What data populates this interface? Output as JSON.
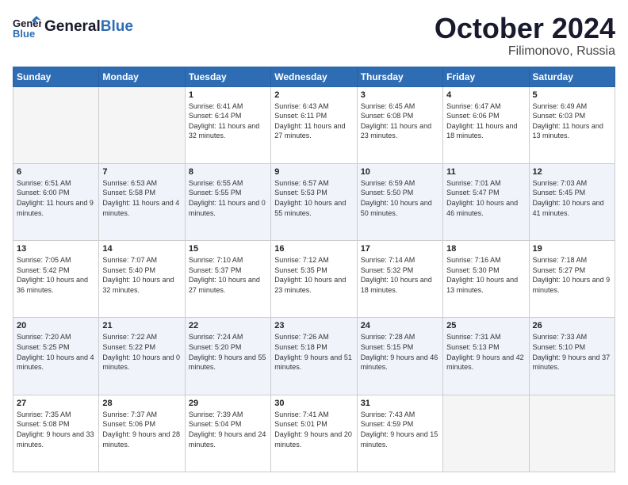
{
  "header": {
    "logo_general": "General",
    "logo_blue": "Blue",
    "month": "October 2024",
    "location": "Filimonovo, Russia"
  },
  "weekdays": [
    "Sunday",
    "Monday",
    "Tuesday",
    "Wednesday",
    "Thursday",
    "Friday",
    "Saturday"
  ],
  "weeks": [
    [
      {
        "day": "",
        "empty": true
      },
      {
        "day": "",
        "empty": true
      },
      {
        "day": "1",
        "sunrise": "Sunrise: 6:41 AM",
        "sunset": "Sunset: 6:14 PM",
        "daylight": "Daylight: 11 hours and 32 minutes."
      },
      {
        "day": "2",
        "sunrise": "Sunrise: 6:43 AM",
        "sunset": "Sunset: 6:11 PM",
        "daylight": "Daylight: 11 hours and 27 minutes."
      },
      {
        "day": "3",
        "sunrise": "Sunrise: 6:45 AM",
        "sunset": "Sunset: 6:08 PM",
        "daylight": "Daylight: 11 hours and 23 minutes."
      },
      {
        "day": "4",
        "sunrise": "Sunrise: 6:47 AM",
        "sunset": "Sunset: 6:06 PM",
        "daylight": "Daylight: 11 hours and 18 minutes."
      },
      {
        "day": "5",
        "sunrise": "Sunrise: 6:49 AM",
        "sunset": "Sunset: 6:03 PM",
        "daylight": "Daylight: 11 hours and 13 minutes."
      }
    ],
    [
      {
        "day": "6",
        "sunrise": "Sunrise: 6:51 AM",
        "sunset": "Sunset: 6:00 PM",
        "daylight": "Daylight: 11 hours and 9 minutes."
      },
      {
        "day": "7",
        "sunrise": "Sunrise: 6:53 AM",
        "sunset": "Sunset: 5:58 PM",
        "daylight": "Daylight: 11 hours and 4 minutes."
      },
      {
        "day": "8",
        "sunrise": "Sunrise: 6:55 AM",
        "sunset": "Sunset: 5:55 PM",
        "daylight": "Daylight: 11 hours and 0 minutes."
      },
      {
        "day": "9",
        "sunrise": "Sunrise: 6:57 AM",
        "sunset": "Sunset: 5:53 PM",
        "daylight": "Daylight: 10 hours and 55 minutes."
      },
      {
        "day": "10",
        "sunrise": "Sunrise: 6:59 AM",
        "sunset": "Sunset: 5:50 PM",
        "daylight": "Daylight: 10 hours and 50 minutes."
      },
      {
        "day": "11",
        "sunrise": "Sunrise: 7:01 AM",
        "sunset": "Sunset: 5:47 PM",
        "daylight": "Daylight: 10 hours and 46 minutes."
      },
      {
        "day": "12",
        "sunrise": "Sunrise: 7:03 AM",
        "sunset": "Sunset: 5:45 PM",
        "daylight": "Daylight: 10 hours and 41 minutes."
      }
    ],
    [
      {
        "day": "13",
        "sunrise": "Sunrise: 7:05 AM",
        "sunset": "Sunset: 5:42 PM",
        "daylight": "Daylight: 10 hours and 36 minutes."
      },
      {
        "day": "14",
        "sunrise": "Sunrise: 7:07 AM",
        "sunset": "Sunset: 5:40 PM",
        "daylight": "Daylight: 10 hours and 32 minutes."
      },
      {
        "day": "15",
        "sunrise": "Sunrise: 7:10 AM",
        "sunset": "Sunset: 5:37 PM",
        "daylight": "Daylight: 10 hours and 27 minutes."
      },
      {
        "day": "16",
        "sunrise": "Sunrise: 7:12 AM",
        "sunset": "Sunset: 5:35 PM",
        "daylight": "Daylight: 10 hours and 23 minutes."
      },
      {
        "day": "17",
        "sunrise": "Sunrise: 7:14 AM",
        "sunset": "Sunset: 5:32 PM",
        "daylight": "Daylight: 10 hours and 18 minutes."
      },
      {
        "day": "18",
        "sunrise": "Sunrise: 7:16 AM",
        "sunset": "Sunset: 5:30 PM",
        "daylight": "Daylight: 10 hours and 13 minutes."
      },
      {
        "day": "19",
        "sunrise": "Sunrise: 7:18 AM",
        "sunset": "Sunset: 5:27 PM",
        "daylight": "Daylight: 10 hours and 9 minutes."
      }
    ],
    [
      {
        "day": "20",
        "sunrise": "Sunrise: 7:20 AM",
        "sunset": "Sunset: 5:25 PM",
        "daylight": "Daylight: 10 hours and 4 minutes."
      },
      {
        "day": "21",
        "sunrise": "Sunrise: 7:22 AM",
        "sunset": "Sunset: 5:22 PM",
        "daylight": "Daylight: 10 hours and 0 minutes."
      },
      {
        "day": "22",
        "sunrise": "Sunrise: 7:24 AM",
        "sunset": "Sunset: 5:20 PM",
        "daylight": "Daylight: 9 hours and 55 minutes."
      },
      {
        "day": "23",
        "sunrise": "Sunrise: 7:26 AM",
        "sunset": "Sunset: 5:18 PM",
        "daylight": "Daylight: 9 hours and 51 minutes."
      },
      {
        "day": "24",
        "sunrise": "Sunrise: 7:28 AM",
        "sunset": "Sunset: 5:15 PM",
        "daylight": "Daylight: 9 hours and 46 minutes."
      },
      {
        "day": "25",
        "sunrise": "Sunrise: 7:31 AM",
        "sunset": "Sunset: 5:13 PM",
        "daylight": "Daylight: 9 hours and 42 minutes."
      },
      {
        "day": "26",
        "sunrise": "Sunrise: 7:33 AM",
        "sunset": "Sunset: 5:10 PM",
        "daylight": "Daylight: 9 hours and 37 minutes."
      }
    ],
    [
      {
        "day": "27",
        "sunrise": "Sunrise: 7:35 AM",
        "sunset": "Sunset: 5:08 PM",
        "daylight": "Daylight: 9 hours and 33 minutes."
      },
      {
        "day": "28",
        "sunrise": "Sunrise: 7:37 AM",
        "sunset": "Sunset: 5:06 PM",
        "daylight": "Daylight: 9 hours and 28 minutes."
      },
      {
        "day": "29",
        "sunrise": "Sunrise: 7:39 AM",
        "sunset": "Sunset: 5:04 PM",
        "daylight": "Daylight: 9 hours and 24 minutes."
      },
      {
        "day": "30",
        "sunrise": "Sunrise: 7:41 AM",
        "sunset": "Sunset: 5:01 PM",
        "daylight": "Daylight: 9 hours and 20 minutes."
      },
      {
        "day": "31",
        "sunrise": "Sunrise: 7:43 AM",
        "sunset": "Sunset: 4:59 PM",
        "daylight": "Daylight: 9 hours and 15 minutes."
      },
      {
        "day": "",
        "empty": true
      },
      {
        "day": "",
        "empty": true
      }
    ]
  ]
}
